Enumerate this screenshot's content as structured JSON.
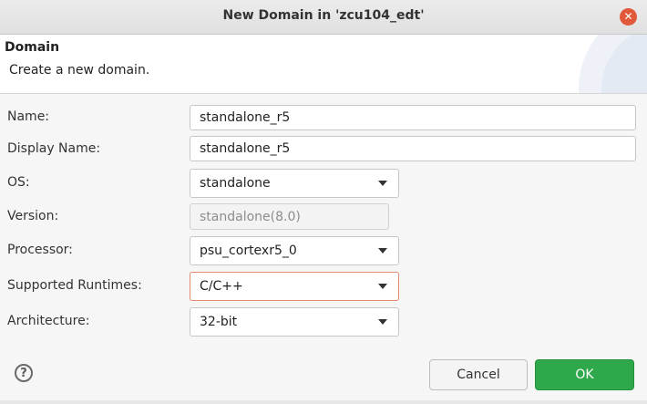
{
  "window": {
    "title": "New Domain in 'zcu104_edt'",
    "close_icon": "close-icon"
  },
  "header": {
    "title": "Domain",
    "description": "Create a new domain."
  },
  "form": {
    "name": {
      "label": "Name:",
      "value": "standalone_r5"
    },
    "display_name": {
      "label": "Display Name:",
      "value": "standalone_r5"
    },
    "os": {
      "label": "OS:",
      "value": "standalone"
    },
    "version": {
      "label": "Version:",
      "value": "standalone(8.0)"
    },
    "processor": {
      "label": "Processor:",
      "value": "psu_cortexr5_0"
    },
    "runtimes": {
      "label": "Supported Runtimes:",
      "value": "C/C++"
    },
    "architecture": {
      "label": "Architecture:",
      "value": "32-bit"
    }
  },
  "footer": {
    "help_icon": "help-icon",
    "help_glyph": "?",
    "cancel_label": "Cancel",
    "ok_label": "OK"
  },
  "colors": {
    "ok_button": "#2ea84a",
    "close_button": "#e2583b",
    "focus_border": "#e68a6f"
  }
}
